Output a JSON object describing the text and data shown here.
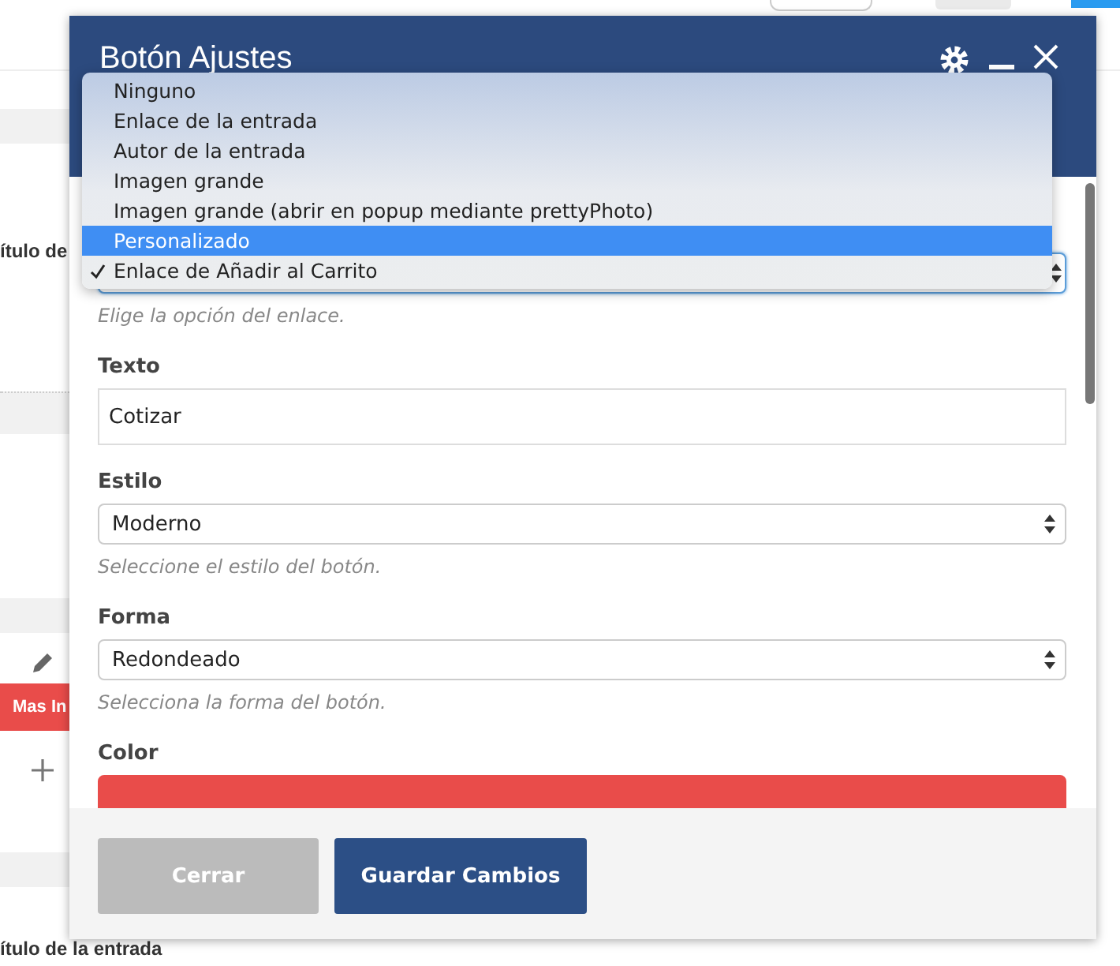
{
  "background_page": {
    "labels": [
      "ítulo de",
      "ítulo de la entrada"
    ],
    "button": "Mas In"
  },
  "dialog": {
    "title": "Botón Ajustes",
    "link_field": {
      "help": "Elige la opción del enlace.",
      "focused": true
    },
    "link_menu": [
      {
        "label": "Ninguno",
        "selected": false,
        "checked": false
      },
      {
        "label": "Enlace de la entrada",
        "selected": false,
        "checked": false
      },
      {
        "label": "Autor de la entrada",
        "selected": false,
        "checked": false
      },
      {
        "label": "Imagen grande",
        "selected": false,
        "checked": false
      },
      {
        "label": "Imagen grande (abrir en popup mediante prettyPhoto)",
        "selected": false,
        "checked": false
      },
      {
        "label": "Personalizado",
        "selected": true,
        "checked": false
      },
      {
        "label": "Enlace de Añadir al Carrito",
        "selected": false,
        "checked": true
      }
    ],
    "fields": [
      {
        "kind": "text",
        "label": "Texto",
        "value": "Cotizar"
      },
      {
        "kind": "select",
        "label": "Estilo",
        "value": "Moderno",
        "help": "Seleccione el estilo del botón."
      },
      {
        "kind": "select",
        "label": "Forma",
        "value": "Redondeado",
        "help": "Selecciona la forma del botón."
      },
      {
        "kind": "color_select",
        "label": "Color",
        "color": "#e94c4a"
      }
    ],
    "buttons": [
      {
        "label": "Cerrar",
        "disabled": true
      },
      {
        "label": "Guardar Cambios",
        "disabled": false
      }
    ]
  }
}
